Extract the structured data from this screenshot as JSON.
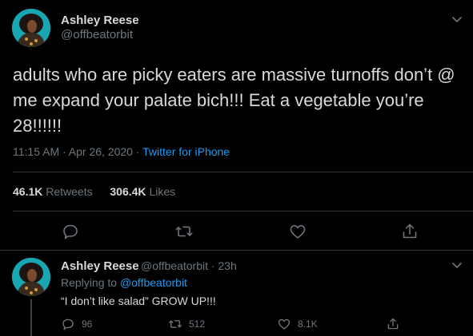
{
  "main_tweet": {
    "display_name": "Ashley Reese",
    "handle": "@offbeatorbit",
    "text": "adults who are picky eaters are massive turnoffs don’t @ me expand your palate bich!!! Eat a vegetable you’re 28!!!!!!",
    "time": "11:15 AM · Apr 26, 2020 · ",
    "source": "Twitter for iPhone",
    "retweets_count": "46.1K",
    "retweets_label": "Retweets",
    "likes_count": "306.4K",
    "likes_label": "Likes"
  },
  "reply_tweet": {
    "display_name": "Ashley Reese",
    "handle_time": "@offbeatorbit · 23h",
    "replying_prefix": "Replying to ",
    "replying_to": "@offbeatorbit",
    "text": "“I don’t like salad” GROW UP!!!",
    "reply_count": "96",
    "retweet_count": "512",
    "like_count": "8.1K"
  },
  "icons": [
    "chevron-down-icon",
    "reply-icon",
    "retweet-icon",
    "like-icon",
    "share-icon"
  ],
  "colors": {
    "background": "#000000",
    "text": "#d9d9d9",
    "muted": "#6e767d",
    "link": "#1d9bf0",
    "divider": "#2f3336"
  }
}
